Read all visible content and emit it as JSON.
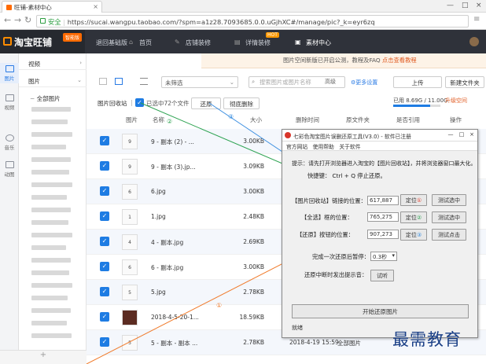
{
  "browser": {
    "tab_title": "旺铺-素材中心",
    "secure_label": "安全",
    "url": "https://sucai.wangpu.taobao.com/?spm=a1z28.7093685.0.0.uGjhXC#/manage/pic?_k=eyr6zq"
  },
  "header": {
    "logo": "淘宝旺铺",
    "logo_badge": "智能版",
    "nav": [
      {
        "label": "退回基础版"
      },
      {
        "label": "首页"
      },
      {
        "label": "店铺装修"
      },
      {
        "label": "详情装修"
      },
      {
        "label": "素材中心"
      }
    ],
    "hot_badge": "HOT"
  },
  "sidebar": {
    "items": [
      {
        "label": "图片"
      },
      {
        "label": "视频"
      },
      {
        "label": "音乐"
      },
      {
        "label": "动图"
      }
    ]
  },
  "panel": {
    "sections": [
      {
        "label": "视频"
      },
      {
        "label": "图片"
      }
    ],
    "tree_root": "全部图片"
  },
  "notice": {
    "text": "图片空间新版已开启公测，教程及FAQ",
    "link": "点击查看教程"
  },
  "toolbar": {
    "select_value": "未筛选",
    "search_placeholder": "搜索图片或图片名称",
    "search_mode": "高级",
    "more_settings": "更多设置",
    "upload": "上传",
    "new_folder": "新建文件夹"
  },
  "usage": {
    "text": "已用 8.69G / 11.00G",
    "fraction": 0.79,
    "upgrade": "升级空间"
  },
  "list": {
    "recycle": "图片回收站",
    "sep": "|",
    "selected_count": "已选中72个文件",
    "restore": "还原",
    "delete_forever": "彻底删除",
    "columns": {
      "pic": "图片",
      "name": "名称",
      "size": "大小",
      "deleted": "删除时间",
      "folder": "原文件夹",
      "cited": "是否引用",
      "ops": "操作"
    },
    "rows": [
      {
        "thumb": "9",
        "name": "9 - 副本 (2) - ...",
        "size": "3.00KB",
        "date": "",
        "tail": ""
      },
      {
        "thumb": "9",
        "name": "9 - 副本 (3).jp...",
        "size": "3.09KB",
        "date": "",
        "tail": ""
      },
      {
        "thumb": "6",
        "name": "6.jpg",
        "size": "3.00KB",
        "date": "",
        "tail": ""
      },
      {
        "thumb": "1",
        "name": "1.jpg",
        "size": "2.48KB",
        "date": "",
        "tail": ""
      },
      {
        "thumb": "4",
        "name": "4 - 副本.jpg",
        "size": "2.69KB",
        "date": "",
        "tail": ""
      },
      {
        "thumb": "6",
        "name": "6 - 副本.jpg",
        "size": "3.00KB",
        "date": "",
        "tail": ""
      },
      {
        "thumb": "5",
        "name": "5.jpg",
        "size": "2.78KB",
        "date": "",
        "tail": ""
      },
      {
        "thumb": "",
        "name": "2018-4-5-20-1...",
        "size": "18.59KB",
        "date": "",
        "tail": ""
      },
      {
        "thumb": "5",
        "name": "5 - 副本 - 副本 ...",
        "size": "2.78KB",
        "date": "2018-4-19 15:59",
        "tail": "全部图片"
      }
    ]
  },
  "dialog": {
    "title": "七彩色淘宝图片误删还原工具(V3.0) - 软件已注册",
    "menu": [
      "官方网站",
      "使用帮助",
      "关于软件"
    ],
    "tip": "提示：请先打开浏览器进入淘宝的【图片回收站】，并将浏览器窗口最大化。",
    "hotkey": "快捷键： Ctrl + Q 停止还原。",
    "rows": [
      {
        "label": "【图片回收站】链接的位置：",
        "value": "617,887",
        "locate": "定位",
        "test": "测试选中"
      },
      {
        "label": "【全选】框的位置：",
        "value": "765,275",
        "locate": "定位",
        "test": "测试选中"
      },
      {
        "label": "【还原】按钮的位置：",
        "value": "907,273",
        "locate": "定位",
        "test": "测试点击"
      }
    ],
    "pause_label": "完成一次还原后暂停：",
    "pause_value": "0.3秒",
    "beep_label": "还原中断时发出提示音：",
    "beep_btn": "试听",
    "start": "开始还原图片",
    "status": "就绪",
    "num1": "①",
    "num2": "②",
    "num3": "③"
  },
  "annotations": {
    "a1": "①",
    "a2": "②",
    "a3": "③"
  },
  "watermark": "最需教育"
}
